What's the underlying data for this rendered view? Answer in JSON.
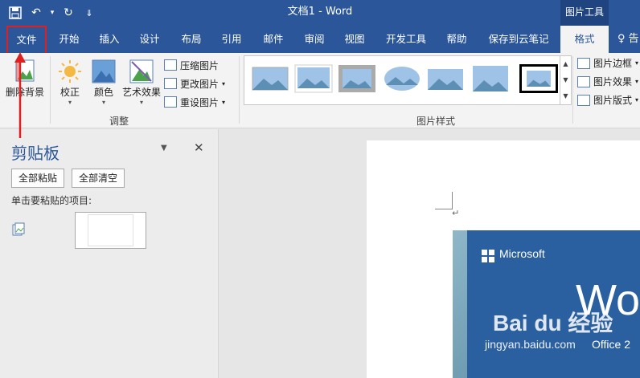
{
  "titlebar": {
    "doc_title": "文档1  -  Word",
    "context_tab": "图片工具",
    "qat": {
      "save": "💾",
      "undo": "↶",
      "undo_arrow": "▾",
      "redo": "↻",
      "customize": "⇓"
    }
  },
  "tabs": [
    "文件",
    "开始",
    "插入",
    "设计",
    "布局",
    "引用",
    "邮件",
    "审阅",
    "视图",
    "开发工具",
    "帮助",
    "保存到云笔记",
    "格式"
  ],
  "tell_me": "♀ 告",
  "ribbon": {
    "remove_bg": "删除背景",
    "corrections": "校正",
    "color": "颜色",
    "artistic": "艺术效果",
    "compress": "压缩图片",
    "change": "更改图片",
    "reset": "重设图片",
    "group_adjust": "调整",
    "group_styles": "图片样式",
    "border": "图片边框",
    "effects": "图片效果",
    "layout": "图片版式"
  },
  "clipboard": {
    "title": "剪贴板",
    "paste_all": "全部粘贴",
    "clear_all": "全部清空",
    "hint": "单击要粘贴的项目:",
    "close": "✕",
    "dropdown": "▼"
  },
  "document": {
    "para_mark": "↵",
    "image_brand": "Microsoft",
    "image_word": "Wo",
    "image_office": "Office 2",
    "watermark": "Bai du 经验",
    "watermark_url": "jingyan.baidu.com"
  },
  "colors": {
    "accent": "#2b579a",
    "annotation": "#e02020"
  }
}
